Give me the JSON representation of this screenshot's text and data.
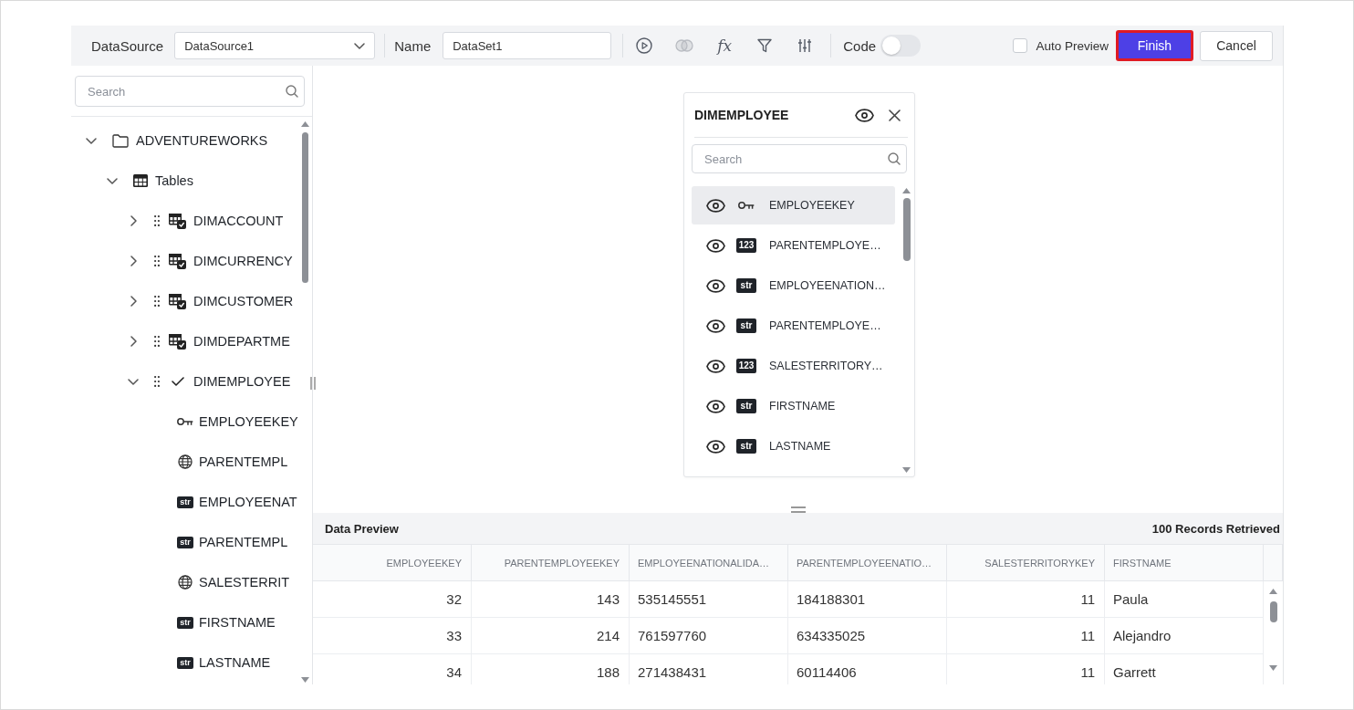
{
  "toolbar": {
    "datasource": {
      "label": "DataSource",
      "value": "DataSource1"
    },
    "name": {
      "label": "Name",
      "value": "DataSet1"
    },
    "tools": [
      {
        "kind": "run",
        "disabled": false
      },
      {
        "kind": "join",
        "disabled": true
      },
      {
        "kind": "expression",
        "text": "fx",
        "disabled": false
      },
      {
        "kind": "filter",
        "disabled": false
      },
      {
        "kind": "columns",
        "disabled": false
      }
    ],
    "code": {
      "label": "Code",
      "on": false
    },
    "auto_preview": {
      "label": "Auto Preview",
      "checked": false
    },
    "buttons": [
      {
        "label": "Finish",
        "kind": "primary",
        "highlighted": true
      },
      {
        "label": "Cancel",
        "kind": "secondary",
        "highlighted": false
      }
    ]
  },
  "left_panel": {
    "search": {
      "placeholder": "Search"
    },
    "tree": [
      {
        "label": "ADVENTUREWORKS",
        "kind": "source",
        "expanded": true,
        "children": [
          {
            "label": "Tables",
            "kind": "group",
            "expanded": true,
            "children": [
              {
                "label": "DIMACCOUNT",
                "kind": "table",
                "expanded": false,
                "checked": false
              },
              {
                "label": "DIMCURRENCY",
                "kind": "table",
                "expanded": false,
                "checked": false
              },
              {
                "label": "DIMCUSTOMER",
                "kind": "table",
                "expanded": false,
                "checked": false
              },
              {
                "label": "DIMDEPARTME",
                "kind": "table",
                "expanded": false,
                "checked": false
              },
              {
                "label": "DIMEMPLOYEE",
                "kind": "table",
                "expanded": true,
                "checked": true,
                "children": [
                  {
                    "label": "EMPLOYEEKEY",
                    "kind": "key"
                  },
                  {
                    "label": "PARENTEMPL",
                    "kind": "number"
                  },
                  {
                    "label": "EMPLOYEENAT",
                    "kind": "string",
                    "badge": "str"
                  },
                  {
                    "label": "PARENTEMPL",
                    "kind": "string",
                    "badge": "str"
                  },
                  {
                    "label": "SALESTERRIT",
                    "kind": "number"
                  },
                  {
                    "label": "FIRSTNAME",
                    "kind": "string",
                    "badge": "str"
                  },
                  {
                    "label": "LASTNAME",
                    "kind": "string",
                    "badge": "str"
                  }
                ]
              }
            ]
          }
        ]
      }
    ]
  },
  "canvas": {
    "table_card": {
      "title": "DIMEMPLOYEE",
      "search": {
        "placeholder": "Search"
      },
      "columns": [
        {
          "name": "EMPLOYEEKEY",
          "kind": "key",
          "visible": true,
          "selected": true
        },
        {
          "name": "PARENTEMPLOYE…",
          "kind": "number",
          "badge": "123",
          "visible": true,
          "selected": false
        },
        {
          "name": "EMPLOYEENATION…",
          "kind": "string",
          "badge": "str",
          "visible": true,
          "selected": false
        },
        {
          "name": "PARENTEMPLOYE…",
          "kind": "string",
          "badge": "str",
          "visible": true,
          "selected": false
        },
        {
          "name": "SALESTERRITORY…",
          "kind": "number",
          "badge": "123",
          "visible": true,
          "selected": false
        },
        {
          "name": "FIRSTNAME",
          "kind": "string",
          "badge": "str",
          "visible": true,
          "selected": false
        },
        {
          "name": "LASTNAME",
          "kind": "string",
          "badge": "str",
          "visible": true,
          "selected": false
        }
      ]
    }
  },
  "data_preview": {
    "title": "Data Preview",
    "status": "100 Records Retrieved",
    "columns": [
      {
        "label": "EMPLOYEEKEY",
        "kind": "number"
      },
      {
        "label": "PARENTEMPLOYEEKEY",
        "kind": "number"
      },
      {
        "label": "EMPLOYEENATIONALIDA…",
        "kind": "string"
      },
      {
        "label": "PARENTEMPLOYEENATIO…",
        "kind": "string"
      },
      {
        "label": "SALESTERRITORYKEY",
        "kind": "number"
      },
      {
        "label": "FIRSTNAME",
        "kind": "string"
      }
    ],
    "rows": [
      [
        "32",
        "143",
        "535145551",
        "184188301",
        "11",
        "Paula"
      ],
      [
        "33",
        "214",
        "761597760",
        "634335025",
        "11",
        "Alejandro"
      ],
      [
        "34",
        "188",
        "271438431",
        "60114406",
        "11",
        "Garrett"
      ]
    ]
  }
}
